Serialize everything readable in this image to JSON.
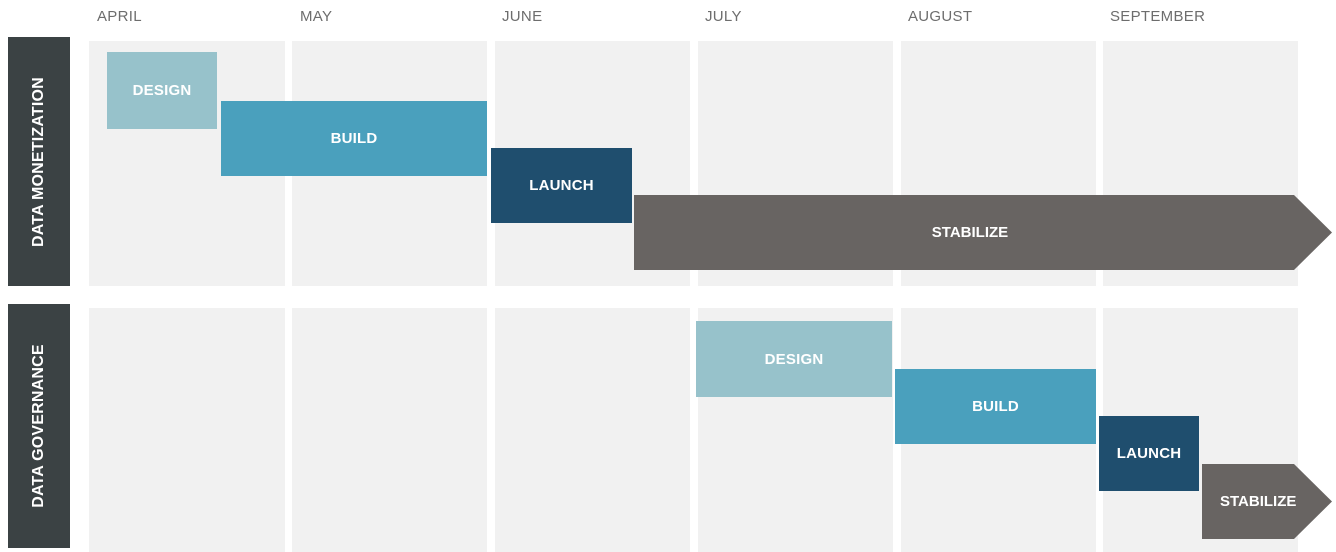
{
  "months": [
    "APRIL",
    "MAY",
    "JUNE",
    "JULY",
    "AUGUST",
    "SEPTEMBER"
  ],
  "rows": [
    {
      "label": "DATA MONETIZATION",
      "phases": [
        "DESIGN",
        "BUILD",
        "LAUNCH",
        "STABILIZE"
      ]
    },
    {
      "label": "DATA GOVERNANCE",
      "phases": [
        "DESIGN",
        "BUILD",
        "LAUNCH",
        "STABILIZE"
      ]
    }
  ],
  "colors": {
    "design": "#97c2cb",
    "build": "#4aa0bd",
    "launch": "#1f4e6e",
    "stabilize": "#686462",
    "row_label_bg": "#3b4244",
    "cell_bg": "#f1f1f1"
  }
}
